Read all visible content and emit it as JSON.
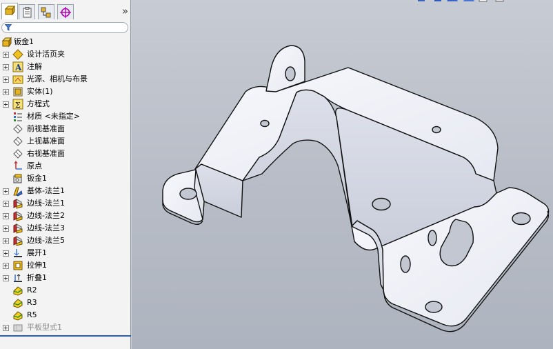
{
  "panel": {
    "tabs": [
      {
        "name": "featuremanager-tab",
        "icon": "featuremanager-icon",
        "active": true
      },
      {
        "name": "propertymanager-tab",
        "icon": "propertymanager-icon",
        "active": false
      },
      {
        "name": "configurationmanager-tab",
        "icon": "configurationmanager-icon",
        "active": false
      },
      {
        "name": "dimxpert-tab",
        "icon": "dimxpert-icon",
        "active": false
      }
    ],
    "collapse_glyph": "»",
    "filter_icon": "filter-icon"
  },
  "tree": {
    "root": {
      "label": "钣金1",
      "icon": "part-icon"
    },
    "items": [
      {
        "label": "设计活页夹",
        "icon": "design-binder-icon",
        "expandable": true
      },
      {
        "label": "注解",
        "icon": "annotations-icon",
        "expandable": true
      },
      {
        "label": "光源、相机与布景",
        "icon": "lights-cameras-icon",
        "expandable": true
      },
      {
        "label": "实体(1)",
        "icon": "solid-bodies-icon",
        "expandable": true
      },
      {
        "label": "方程式",
        "icon": "equations-icon",
        "expandable": true
      },
      {
        "label": "材质 <未指定>",
        "icon": "material-icon",
        "expandable": false
      },
      {
        "label": "前视基准面",
        "icon": "plane-icon",
        "expandable": false
      },
      {
        "label": "上视基准面",
        "icon": "plane-icon",
        "expandable": false
      },
      {
        "label": "右视基准面",
        "icon": "plane-icon",
        "expandable": false
      },
      {
        "label": "原点",
        "icon": "origin-icon",
        "expandable": false
      },
      {
        "label": "钣金1",
        "icon": "sheet-metal-icon",
        "expandable": false
      },
      {
        "label": "基体-法兰1",
        "icon": "base-flange-icon",
        "expandable": true
      },
      {
        "label": "边线-法兰1",
        "icon": "edge-flange-icon",
        "expandable": true
      },
      {
        "label": "边线-法兰2",
        "icon": "edge-flange-icon",
        "expandable": true
      },
      {
        "label": "边线-法兰3",
        "icon": "edge-flange-icon",
        "expandable": true
      },
      {
        "label": "边线-法兰5",
        "icon": "edge-flange-icon",
        "expandable": true
      },
      {
        "label": "展开1",
        "icon": "unfold-icon",
        "expandable": true
      },
      {
        "label": "拉伸1",
        "icon": "extrude-cut-icon",
        "expandable": true
      },
      {
        "label": "折叠1",
        "icon": "fold-icon",
        "expandable": true
      },
      {
        "label": "R2",
        "icon": "fillet-icon",
        "expandable": false
      },
      {
        "label": "R3",
        "icon": "fillet-icon",
        "expandable": false
      },
      {
        "label": "R5",
        "icon": "fillet-icon",
        "expandable": false
      },
      {
        "label": "平板型式1",
        "icon": "flat-pattern-icon",
        "expandable": true,
        "suppressed": true
      }
    ]
  },
  "viewport": {
    "toolbar_icons": [
      "view-orientation-icon",
      "display-style-icon",
      "section-view-icon",
      "hide-show-icon",
      "appearance-icon",
      "scene-icon"
    ],
    "model": "sheet-metal-bracket"
  },
  "colors": {
    "panel_bg": "#f3f3f3",
    "viewport_top": "#c7cbd3",
    "viewport_bottom": "#aeb4bf",
    "model_face": "#f4f5fa",
    "model_edge": "#111111",
    "selection_accent": "#2e5ea8"
  }
}
